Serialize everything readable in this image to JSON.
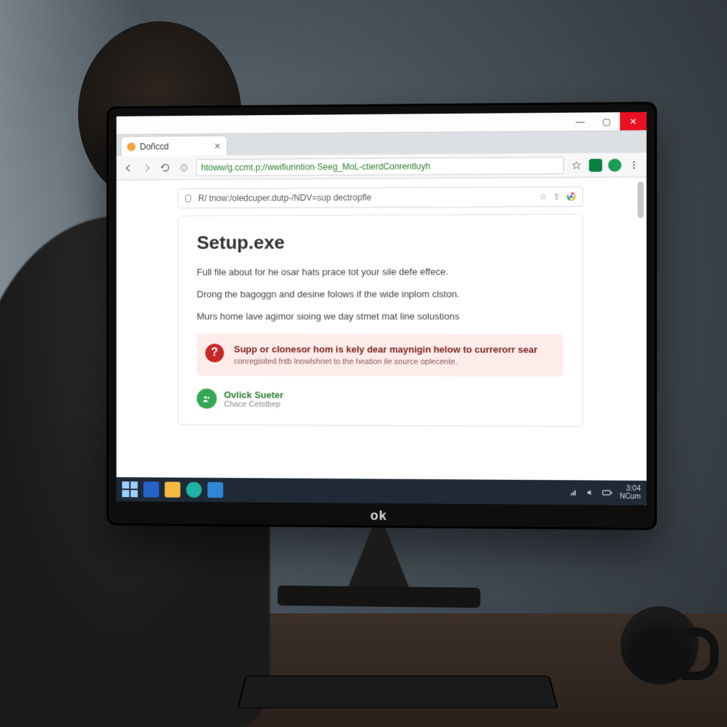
{
  "monitor": {
    "brand": "ok"
  },
  "window_controls": {
    "min": "—",
    "max": "▢",
    "close": "✕"
  },
  "tab": {
    "title": "Doñccd",
    "close": "✕"
  },
  "toolbar": {
    "url_display": "htoww/g.ccmt.p;//wwifiurintion·Seeg_MoL-ctierdConrentluyh"
  },
  "page": {
    "inner_url": "R/ tnow:/oledcuper.dutp-/NDV=sup dectropfle",
    "title": "Setup.exe",
    "para1": "Full file about for he osar hats prace tot your sile defe effece.",
    "para2": "Drong the bagoggn and desine folows if the wide inplom clston.",
    "para3": "Murs home lave agimor sioing we day stmet mat line solustions",
    "alert": {
      "badge": "?",
      "title": "Supp or clonesor hom is kely dear maynigin helow to currerorr sear",
      "sub": "conregisited fntb lnowlshnet to the heation ile source oplecente."
    },
    "verify": {
      "title": "Ovlick Sueter",
      "sub": "Chace Cetstbep"
    }
  },
  "taskbar": {
    "clock_time": "3:04",
    "clock_sub": "NCum"
  }
}
